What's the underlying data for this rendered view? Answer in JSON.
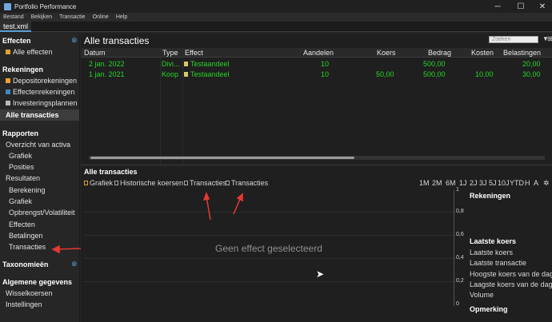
{
  "window": {
    "title": "Portfolio Performance",
    "min": "─",
    "max": "☐",
    "close": "✕"
  },
  "menu": [
    "Bestand",
    "Bekijken",
    "Transactie",
    "Online",
    "Help"
  ],
  "tab": {
    "label": "test.xml"
  },
  "sidebar": {
    "effecten": {
      "head": "Effecten",
      "items": [
        "Alle effecten"
      ]
    },
    "rekeningen": {
      "head": "Rekeningen",
      "items": [
        "Depositorekeningen",
        "Effectenrekeningen",
        "Investeringsplannen"
      ]
    },
    "active": "Alle transacties",
    "rapporten": {
      "head": "Rapporten",
      "items": [
        "Overzicht van activa",
        "Grafiek",
        "Posities",
        "Resultaten",
        "Berekening",
        "Grafiek",
        "Opbrengst/Volatiliteit",
        "Effecten",
        "Betalingen",
        "Transacties"
      ]
    },
    "taxonomie": {
      "head": "Taxonomieën"
    },
    "algemeen": {
      "head": "Algemene gegevens",
      "items": [
        "Wisselkoersen",
        "Instellingen"
      ]
    }
  },
  "main": {
    "title": "Alle transacties",
    "search_placeholder": "Zoeken",
    "columns": [
      "Datum",
      "Type",
      "Effect",
      "Aandelen",
      "Koers",
      "Bedrag",
      "Kosten",
      "Belastingen"
    ],
    "rows": [
      {
        "date": "2 jan. 2022",
        "type": "Divi...",
        "effect": "Testaandeel",
        "shares": "10",
        "price": "",
        "amount": "500,00",
        "fees": "",
        "taxes": "20,00"
      },
      {
        "date": "1 jan. 2021",
        "type": "Koop",
        "effect": "Testaandeel",
        "shares": "10",
        "price": "50,00",
        "amount": "500,00",
        "fees": "10,00",
        "taxes": "30,00"
      }
    ]
  },
  "bottom": {
    "title": "Alle transacties",
    "tabs": [
      "Grafiek",
      "Historische koersen",
      "Transacties",
      "Transacties"
    ],
    "ranges": [
      "1M",
      "2M",
      "6M",
      "1J",
      "2J",
      "3J",
      "5J",
      "10J",
      "YTD",
      "H",
      "A"
    ],
    "empty": "Geen effect geselecteerd",
    "yticks": [
      "1",
      "0,8",
      "0,6",
      "0,4",
      "0,2",
      "0"
    ],
    "info": {
      "rekeningen": "Rekeningen",
      "laatste_koers_head": "Laatste koers",
      "items": [
        "Laatste koers",
        "Laatste transactie",
        "Hoogste koers van de dag",
        "Laagste koers van de dag",
        "Volume"
      ],
      "opmerking": "Opmerking"
    }
  },
  "colors": {
    "green": "#26d426",
    "annotation": "#e53935"
  }
}
